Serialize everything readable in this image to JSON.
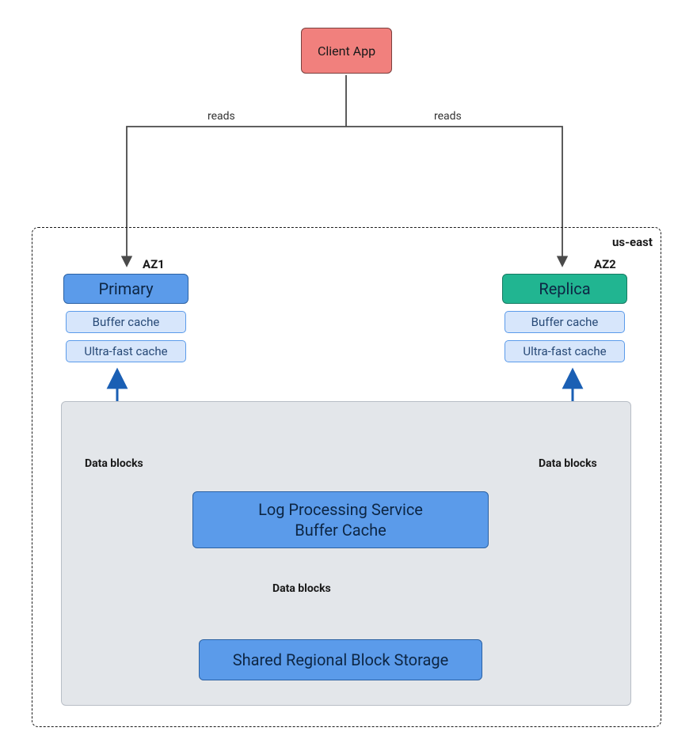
{
  "client": {
    "label": "Client App"
  },
  "region": {
    "label": "us-east"
  },
  "az1": {
    "label": "AZ1",
    "role": "Primary",
    "cache1": "Buffer cache",
    "cache2": "Ultra-fast cache"
  },
  "az2": {
    "label": "AZ2",
    "role": "Replica",
    "cache1": "Buffer cache",
    "cache2": "Ultra-fast cache"
  },
  "lps": {
    "line1": "Log Processing Service",
    "line2": "Buffer Cache"
  },
  "storage": {
    "label": "Shared Regional Block Storage"
  },
  "edges": {
    "reads_left": "reads",
    "reads_right": "reads",
    "data_left": "Data blocks",
    "data_right": "Data blocks",
    "data_mid": "Data blocks"
  }
}
